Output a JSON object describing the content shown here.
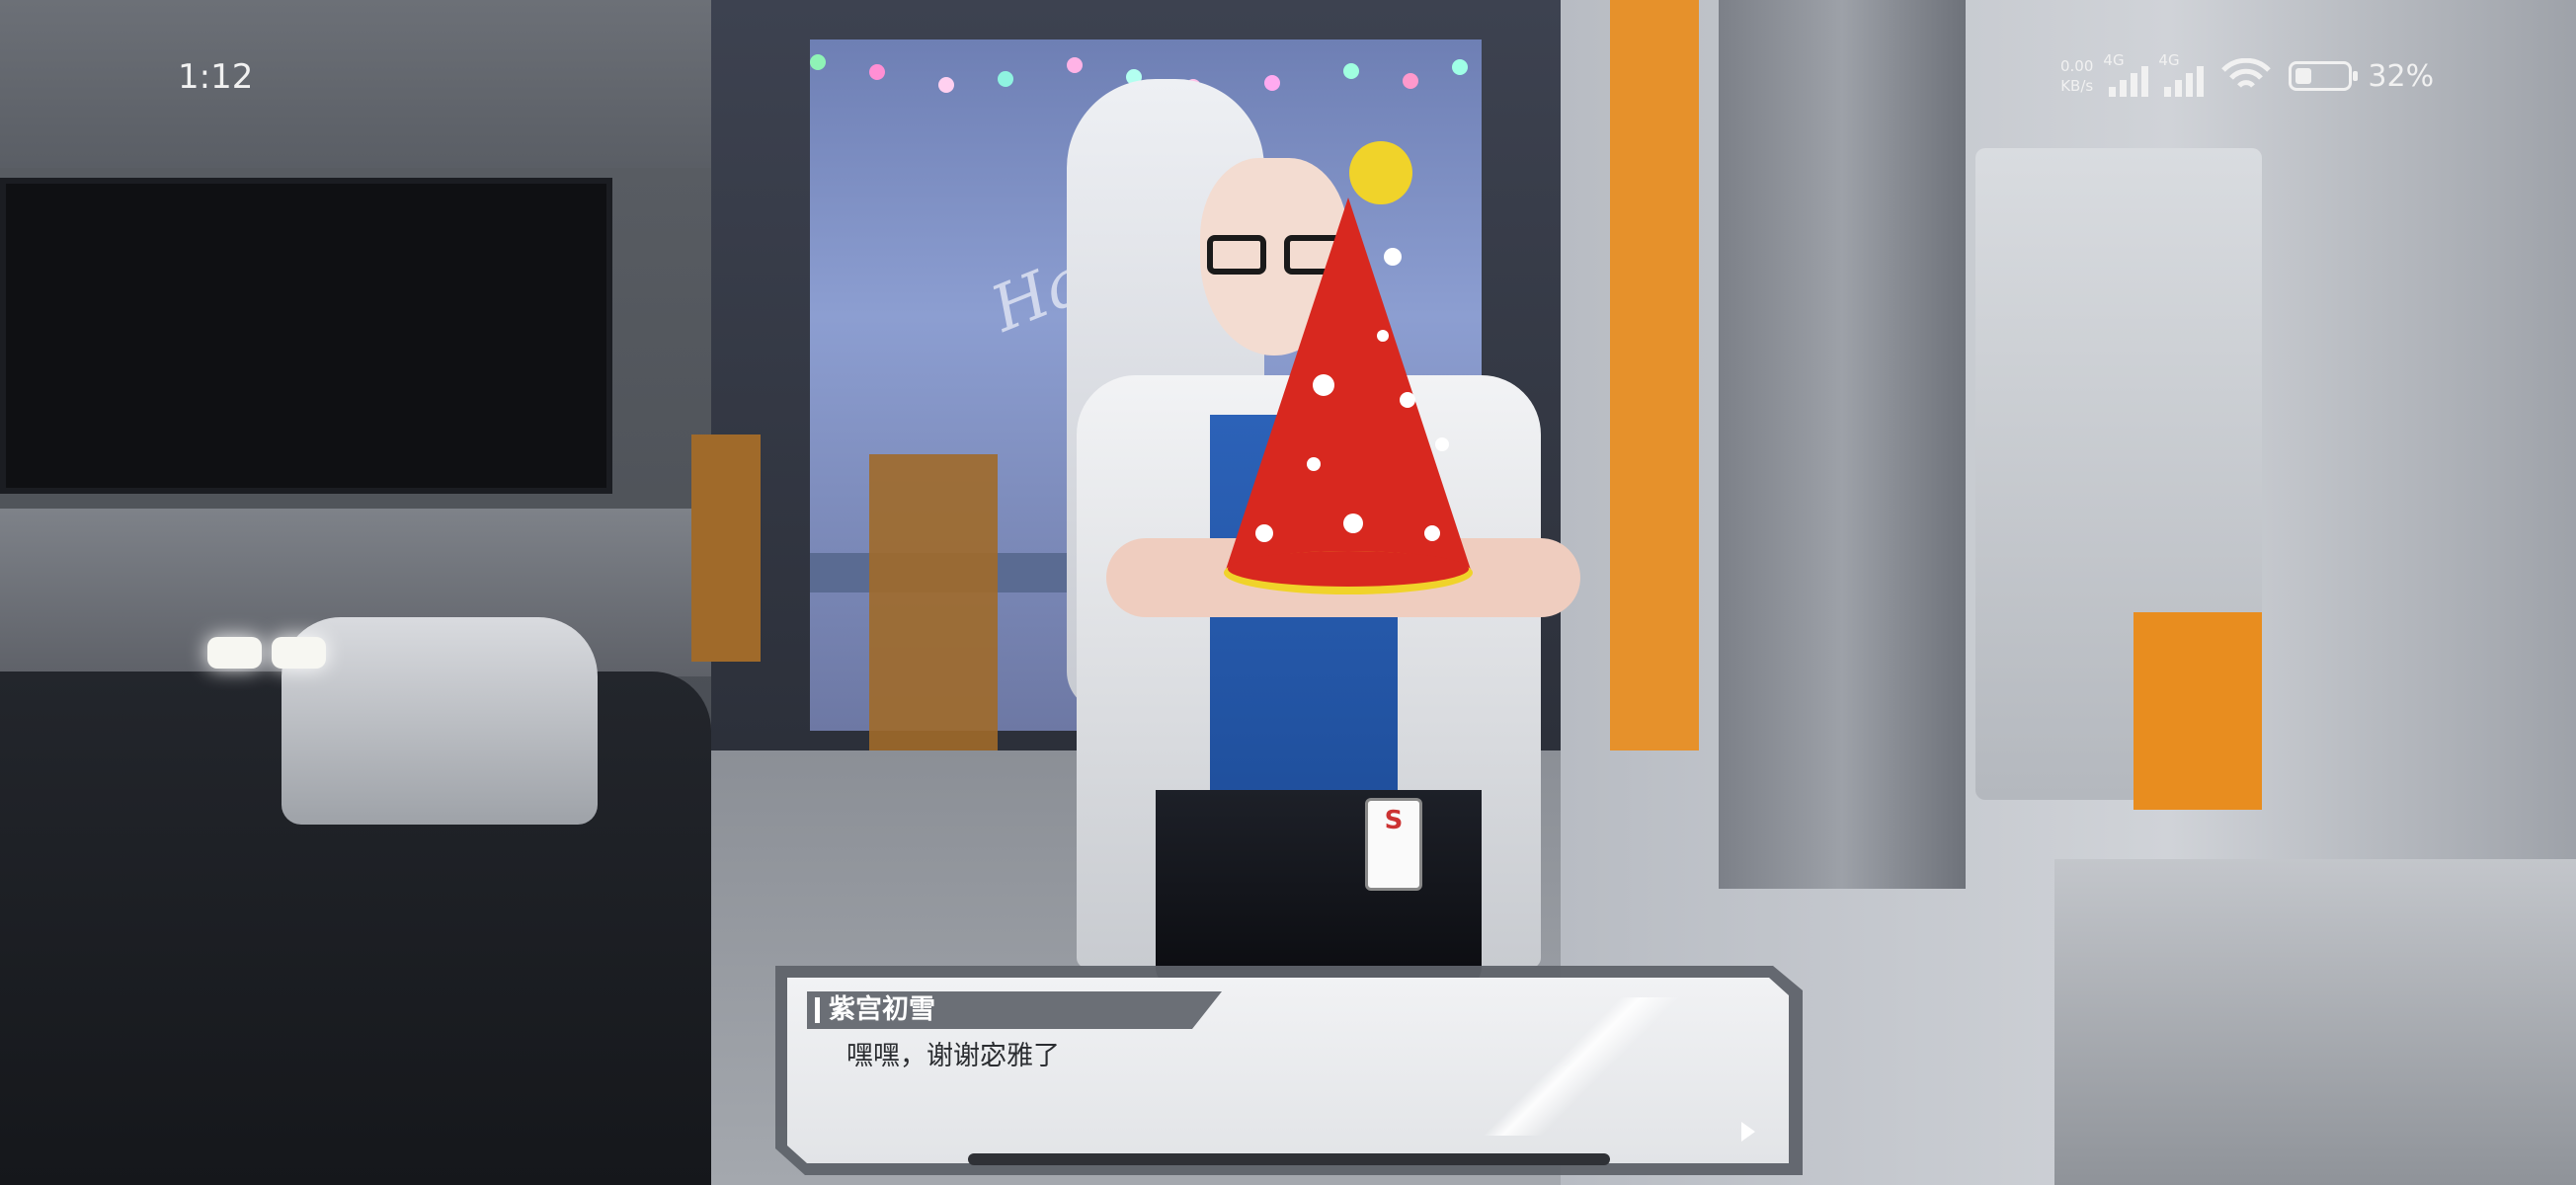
{
  "status_bar": {
    "time": "1:12",
    "net_speed_value": "0.00",
    "net_speed_unit": "KB/s",
    "sim1_label": "4G",
    "sim2_label": "4G",
    "battery_percent": "32%",
    "battery_level": 0.32
  },
  "scene": {
    "background_sign": "Happy",
    "badge_letter": "S"
  },
  "dialogue": {
    "speaker": "紫宫初雪",
    "line": "嘿嘿，谢谢宓雅了"
  },
  "colors": {
    "hat_red": "#d8281f",
    "hat_trim": "#f0d32a",
    "shirt_blue": "#2c62b8",
    "accent_orange": "#e6912b"
  }
}
